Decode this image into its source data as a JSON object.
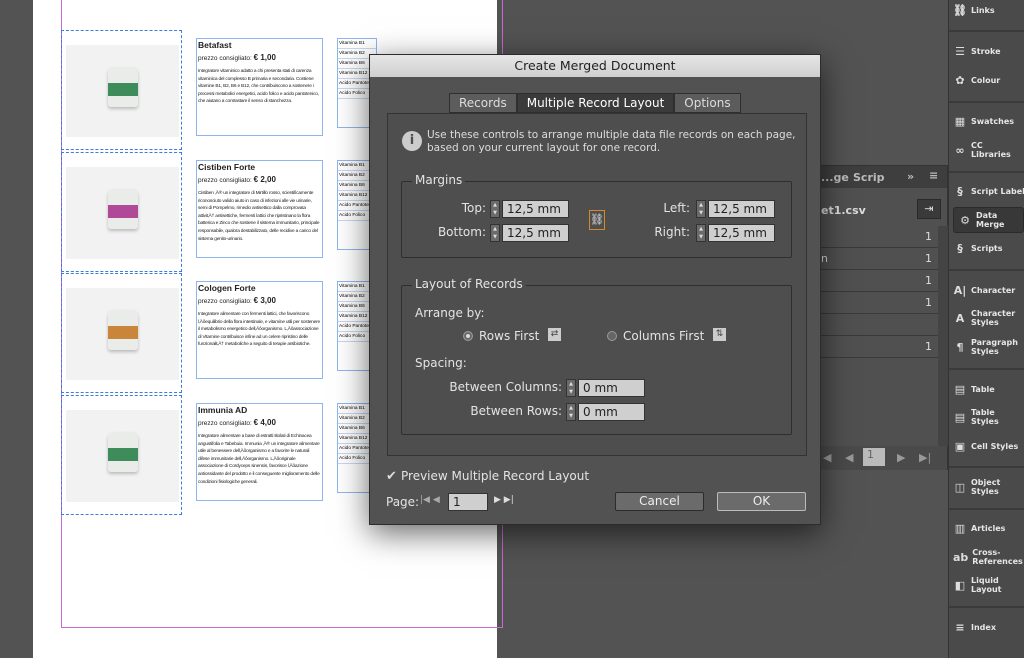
{
  "dialog": {
    "title": "Create Merged Document",
    "tabs": [
      "Records",
      "Multiple Record Layout",
      "Options"
    ],
    "active_tab": "Multiple Record Layout",
    "info_line1": "Use these controls to arrange multiple data file records on each page,",
    "info_line2": "based on your current layout for one record.",
    "margins": {
      "label": "Margins",
      "top_label": "Top:",
      "top": "12,5 mm",
      "bottom_label": "Bottom:",
      "bottom": "12,5 mm",
      "left_label": "Left:",
      "left": "12,5 mm",
      "right_label": "Right:",
      "right": "12,5 mm"
    },
    "layout": {
      "label": "Layout of Records",
      "arrange_label": "Arrange by:",
      "rows_first": "Rows First",
      "columns_first": "Columns First",
      "selected": "Rows First",
      "spacing_label": "Spacing:",
      "between_columns_label": "Between Columns:",
      "between_columns": "0 mm",
      "between_rows_label": "Between Rows:",
      "between_rows": "0 mm"
    },
    "preview_label": "Preview Multiple Record Layout",
    "preview_checked": true,
    "page_label": "Page:",
    "page_value": "1",
    "cancel": "Cancel",
    "ok": "OK"
  },
  "document": {
    "records": [
      {
        "name": "Betafast",
        "price_label": "prezzo consigliato:",
        "price": "€ 1,00",
        "desc": "Integratore vitaminico adatto a chi presenta stati di carenza vitaminica del complesso B primaria e secondaria. Contiene vitamine B1, B2, B6 e B12, che contribuiscono a sostenere i processi metabolici energetici, acido folico e acido pantotenico, che aiutano a contrastare il senso di stanchezza."
      },
      {
        "name": "Cistiben Forte",
        "price_label": "prezzo consigliato:",
        "price": "€ 2,00",
        "desc": "Cistiben ‚Ä® un integratore di Mirtillo rosso, scientificamente riconosciuto valido aiuto in caso di infezioni alle vie urinarie, semi di Pompelmo, rimedio antisettico dalla comprovata attivit‚Ä† antisettiche, fermenti lattici che ripristinano la flora batterica e Zinco che sostiene il sistema immunitario, principale responsabile, qualora destabilizzato, delle recidive a carico del sistema genito-urinario."
      },
      {
        "name": "Cologen Forte",
        "price_label": "prezzo consigliato:",
        "price": "€ 3,00",
        "desc": "Integratore alimentare con fermenti lattici, che favoriscono l‚Äôequilibrio della flora intestinale, e vitamine utili per sostenere il metabolismo energetico dell‚Äôorganismo. L‚Äôassociazione di Vitamine contribuisce infine ad un celere ripristino delle funzionalit‚Ä† metaboliche a seguito di terapie antibiotiche."
      },
      {
        "name": "Immunia AD",
        "price_label": "prezzo consigliato:",
        "price": "€ 4,00",
        "desc": "Integratore alimentare a base di estratti titolati di Echinacea angustifolia e Tabebuia. Immunia ‚Ä® un integratore alimentare utile al benessere dell‚Äôorganismo e a favorire le naturali difese immunitarie dell‚Äôorganismo. L‚Äôoriginale associazione di Cordyceps sinensis, favorisce l‚Äôazione antiossidante del prodotto e il conseguente miglioramento delle condizioni fisiologiche generali."
      }
    ],
    "table_rows": [
      "Vitamina B1",
      "Vitamina B2",
      "Vitamina B6",
      "Vitamina B12",
      "Acido Pantotenico",
      "Acido Folico"
    ],
    "label_colors": [
      "#3d8c5a",
      "#b04a98",
      "#c9853a",
      "#3d8c5a"
    ]
  },
  "data_merge_panel": {
    "tabs": [
      "...ge",
      "Scrip"
    ],
    "source": "et1.csv",
    "rows": [
      "",
      "n",
      "",
      "",
      "",
      ""
    ],
    "values": [
      "1",
      "1",
      "1",
      "1",
      "",
      "1"
    ],
    "page": "1"
  },
  "right_panel": {
    "items": [
      {
        "label": "Links",
        "icon": "link-icon",
        "ch": "⛓"
      },
      {
        "label": "Stroke",
        "icon": "stroke-icon",
        "ch": "☰"
      },
      {
        "label": "Colour",
        "icon": "palette-icon",
        "ch": "✿"
      },
      {
        "label": "Swatches",
        "icon": "swatches-icon",
        "ch": "▦"
      },
      {
        "label": "CC Libraries",
        "icon": "cc-icon",
        "ch": "∞"
      },
      {
        "label": "Script Label",
        "icon": "script-label-icon",
        "ch": "§"
      },
      {
        "label": "Data Merge",
        "icon": "data-merge-icon",
        "ch": "⚙"
      },
      {
        "label": "Scripts",
        "icon": "scripts-icon",
        "ch": "§"
      },
      {
        "label": "Character",
        "icon": "character-icon",
        "ch": "A|"
      },
      {
        "label": "Character Styles",
        "icon": "character-styles-icon",
        "ch": "A"
      },
      {
        "label": "Paragraph Styles",
        "icon": "paragraph-styles-icon",
        "ch": "¶"
      },
      {
        "label": "Table",
        "icon": "table-icon",
        "ch": "▤"
      },
      {
        "label": "Table Styles",
        "icon": "table-styles-icon",
        "ch": "▤"
      },
      {
        "label": "Cell Styles",
        "icon": "cell-styles-icon",
        "ch": "▣"
      },
      {
        "label": "Object Styles",
        "icon": "object-styles-icon",
        "ch": "◫"
      },
      {
        "label": "Articles",
        "icon": "articles-icon",
        "ch": "▥"
      },
      {
        "label": "Cross-References",
        "icon": "cross-ref-icon",
        "ch": "ab"
      },
      {
        "label": "Liquid Layout",
        "icon": "liquid-layout-icon",
        "ch": "◧"
      },
      {
        "label": "Index",
        "icon": "index-icon",
        "ch": "≡"
      }
    ],
    "selected": "Data Merge"
  }
}
